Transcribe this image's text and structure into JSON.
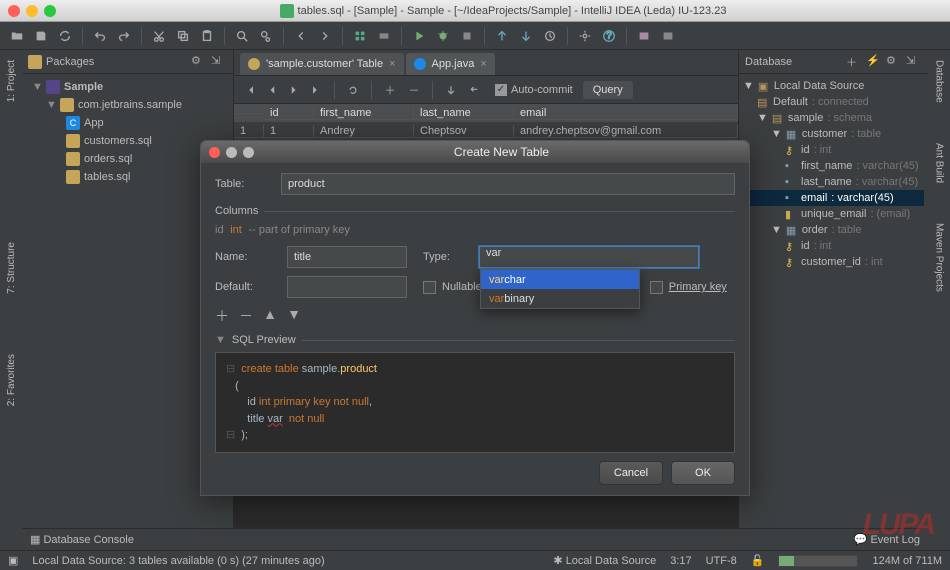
{
  "window": {
    "title": "tables.sql - [Sample] - Sample - [~/IdeaProjects/Sample] - IntelliJ IDEA (Leda) IU-123.23"
  },
  "left_sidebar_tabs": [
    "1: Project",
    "7: Structure",
    "2: Favorites"
  ],
  "right_sidebar_tabs": [
    "Database",
    "Ant Build",
    "Maven Projects"
  ],
  "project_pane": {
    "header": "Packages",
    "tree": {
      "root": "Sample",
      "pkg": "com.jetbrains.sample",
      "items": [
        "App",
        "customers.sql",
        "orders.sql",
        "tables.sql"
      ]
    }
  },
  "editor_tabs": [
    {
      "label": "'sample.customer' Table",
      "icon": "table"
    },
    {
      "label": "App.java",
      "icon": "class"
    }
  ],
  "table_viewer": {
    "auto_commit_label": "Auto-commit",
    "query_label": "Query",
    "columns": [
      "id",
      "first_name",
      "last_name",
      "email"
    ],
    "rows": [
      {
        "n": "1",
        "id": "1",
        "first_name": "Andrey",
        "last_name": "Cheptsov",
        "email": "andrey.cheptsov@gmail.com"
      }
    ]
  },
  "database_pane": {
    "header": "Database",
    "tree": {
      "root": "Local Data Source",
      "default_schema": "Default: connected",
      "schema": "sample: schema",
      "tables": [
        {
          "name": "customer",
          "type_suffix": "table",
          "cols": [
            {
              "name": "id",
              "type": "int",
              "pk": true
            },
            {
              "name": "first_name",
              "type": "varchar(45)"
            },
            {
              "name": "last_name",
              "type": "varchar(45)"
            },
            {
              "name": "email",
              "type": "varchar(45)",
              "selected": true
            },
            {
              "name": "unique_email",
              "type": "(email)",
              "index": true
            }
          ]
        },
        {
          "name": "order",
          "type_suffix": "table",
          "cols": [
            {
              "name": "id",
              "type": "int",
              "pk": true
            },
            {
              "name": "customer_id",
              "type": "int"
            }
          ]
        }
      ]
    }
  },
  "dialog": {
    "title": "Create New Table",
    "table_label": "Table:",
    "table_value": "product",
    "columns_section": "Columns",
    "pk_preview": {
      "name": "id",
      "type": "int",
      "comment": "-- part of primary key"
    },
    "name_label": "Name:",
    "name_value": "title",
    "type_label": "Type:",
    "type_value": "var",
    "default_label": "Default:",
    "default_value": "",
    "nullable_label": "Nullable",
    "primary_key_label": "Primary key",
    "autocomplete": [
      {
        "prefix": "var",
        "rest": "char",
        "selected": true
      },
      {
        "prefix": "var",
        "rest": "binary",
        "selected": false
      }
    ],
    "sql_preview_label": "SQL Preview",
    "sql_lines": [
      "create table sample.product",
      "(",
      "    id int primary key not null,",
      "    title var  not null",
      ");"
    ],
    "cancel": "Cancel",
    "ok": "OK"
  },
  "bottom_strip": {
    "db_console": "Database Console",
    "event_log": "Event Log"
  },
  "statusbar": {
    "message": "Local Data Source: 3 tables available (0 s) (27 minutes ago)",
    "ds": "Local Data Source",
    "caret": "3:17",
    "encoding": "UTF-8",
    "mem": "124M of 711M",
    "mem_pct": 18
  },
  "watermark": "LUPA"
}
